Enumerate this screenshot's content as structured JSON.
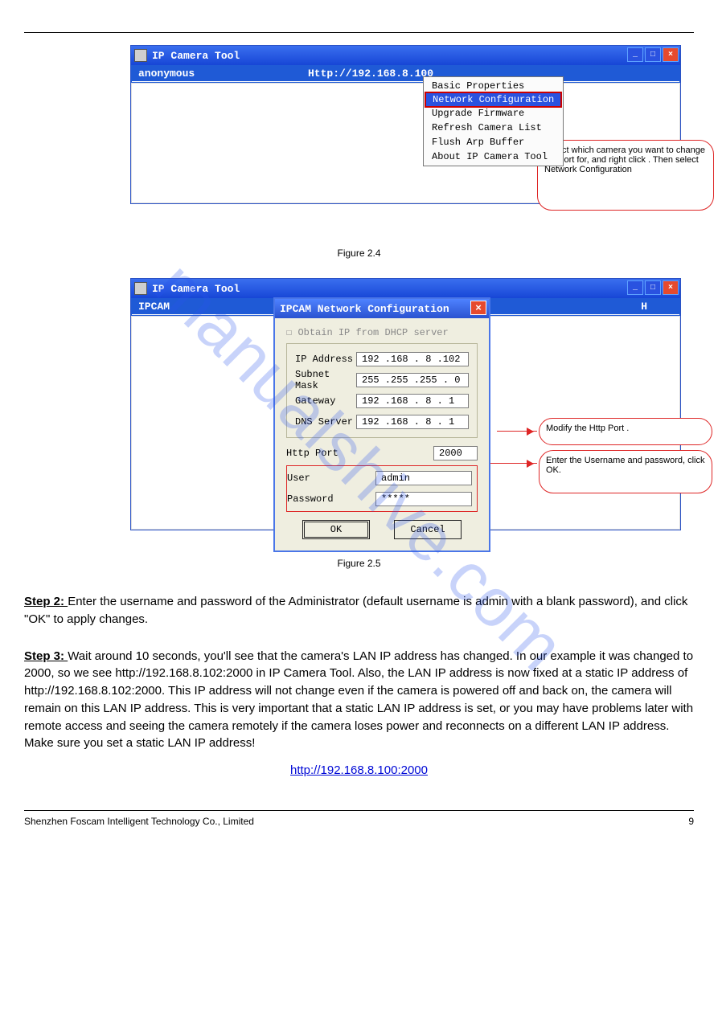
{
  "watermark": "manualshive.com",
  "shot1": {
    "title": "IP Camera Tool",
    "row_left": "anonymous",
    "row_url": "Http://192.168.8.100",
    "menu": {
      "items": [
        "Basic Properties",
        "Network Configuration",
        "Upgrade Firmware",
        "Refresh Camera List",
        "Flush Arp Buffer",
        "About IP Camera Tool"
      ],
      "selected_index": 1
    },
    "callout": "Select which camera you want to change the port for, and right click . Then select Network Configuration"
  },
  "fig1_caption": "Figure 2.4",
  "shot2": {
    "title_outer": "IP Camera Tool",
    "row_left": "IPCAM",
    "row_right": "H",
    "dlg_title": "IPCAM Network Configuration",
    "dhcp_label": "Obtain IP from DHCP server",
    "fields": {
      "ip_label": "IP Address",
      "ip_val": "192 .168 . 8 .102",
      "mask_label": "Subnet Mask",
      "mask_val": "255 .255 .255 . 0",
      "gw_label": "Gateway",
      "gw_val": "192 .168 . 8 . 1",
      "dns_label": "DNS Server",
      "dns_val": "192 .168 . 8 . 1",
      "port_label": "Http Port",
      "port_val": "2000",
      "user_label": "User",
      "user_val": "admin",
      "pwd_label": "Password",
      "pwd_val": "*****"
    },
    "ok_label": "OK",
    "cancel_label": "Cancel",
    "callout_port": "Modify the Http Port .",
    "callout_cred": "Enter the Username and password, click OK."
  },
  "fig2_caption": "Figure 2.5",
  "text": {
    "p1a": "Step 2: ",
    "p1b": "Enter the username and password of the Administrator (default username is admin with a blank password), and click \"OK\" to apply changes.",
    "p2a": "Step 3: ",
    "p2b": "Wait around 10 seconds, you'll see that the camera's LAN IP address has changed. In our example it was changed to 2000, so we see http://192.168.8.102:2000 in IP Camera Tool. Also, the LAN IP address is now fixed at a static IP address of http://192.168.8.102:2000. This IP address will not change even if the camera is powered off and back on, the camera will remain on this LAN IP address. This is very important that a static LAN IP address is set, or you may have problems later with remote access and seeing the camera remotely if the camera loses power and reconnects on a different LAN IP address. Make sure you set a static LAN IP address!",
    "link": "http://192.168.8.100:2000"
  },
  "footer": {
    "copyright": "Shenzhen Foscam Intelligent Technology Co., Limited",
    "page": "9"
  }
}
